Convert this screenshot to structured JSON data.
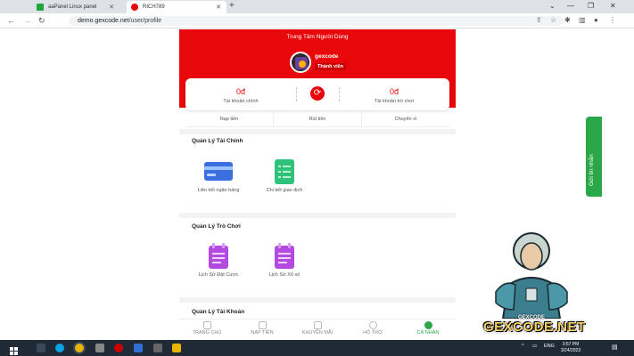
{
  "browser": {
    "tabs": [
      {
        "title": "aaPanel Linux panel",
        "icon": "aapanel-icon"
      },
      {
        "title": "RICH789",
        "icon": "rich789-icon"
      }
    ],
    "url_domain": "demo.gexcode.net",
    "url_path": "/user/profile"
  },
  "header": {
    "title": "Trung Tâm Người Dùng",
    "username": "gexcode",
    "role": "Thành viên"
  },
  "balance": {
    "main_value": "0đ",
    "main_label": "Tài khoản chính",
    "game_value": "0đ",
    "game_label": "Tài khoản trò chơi"
  },
  "actions": [
    "Nạp tiền",
    "Rút tiền",
    "Chuyển ví"
  ],
  "finance": {
    "title": "Quản Lý Tài Chính",
    "items": [
      {
        "label": "Liên kết ngân hàng",
        "icon": "bank-card-icon"
      },
      {
        "label": "Chi tiết giao dịch",
        "icon": "transaction-doc-icon"
      }
    ]
  },
  "games": {
    "title": "Quản Lý Trò Chơi",
    "items": [
      {
        "label": "Lịch Sử Đặt Cược",
        "icon": "bet-history-icon"
      },
      {
        "label": "Lịch Sử Xổ số",
        "icon": "lottery-history-icon"
      }
    ]
  },
  "account": {
    "title": "Quản Lý Tài Khoản"
  },
  "bottom_nav": [
    {
      "label": "TRANG CHỦ",
      "icon": "home-icon",
      "active": false
    },
    {
      "label": "NẠP TIỀN",
      "icon": "deposit-icon",
      "active": false
    },
    {
      "label": "KHUYẾN MÃI",
      "icon": "gift-icon",
      "active": false
    },
    {
      "label": "HỖ TRỢ",
      "icon": "support-icon",
      "active": false
    },
    {
      "label": "CÁ NHÂN",
      "icon": "user-icon",
      "active": true
    }
  ],
  "side_tab": {
    "label": "Gửi tin nhắn"
  },
  "watermark": {
    "top": "GEXCODE",
    "brand": "GEXCODE.NET"
  },
  "taskbar": {
    "lang": "ENG",
    "time": "3:57 PM",
    "date": "3/24/2023"
  },
  "colors": {
    "primary": "#e8070a",
    "accent_green": "#2aa848",
    "taskbar": "#1f2a36"
  }
}
